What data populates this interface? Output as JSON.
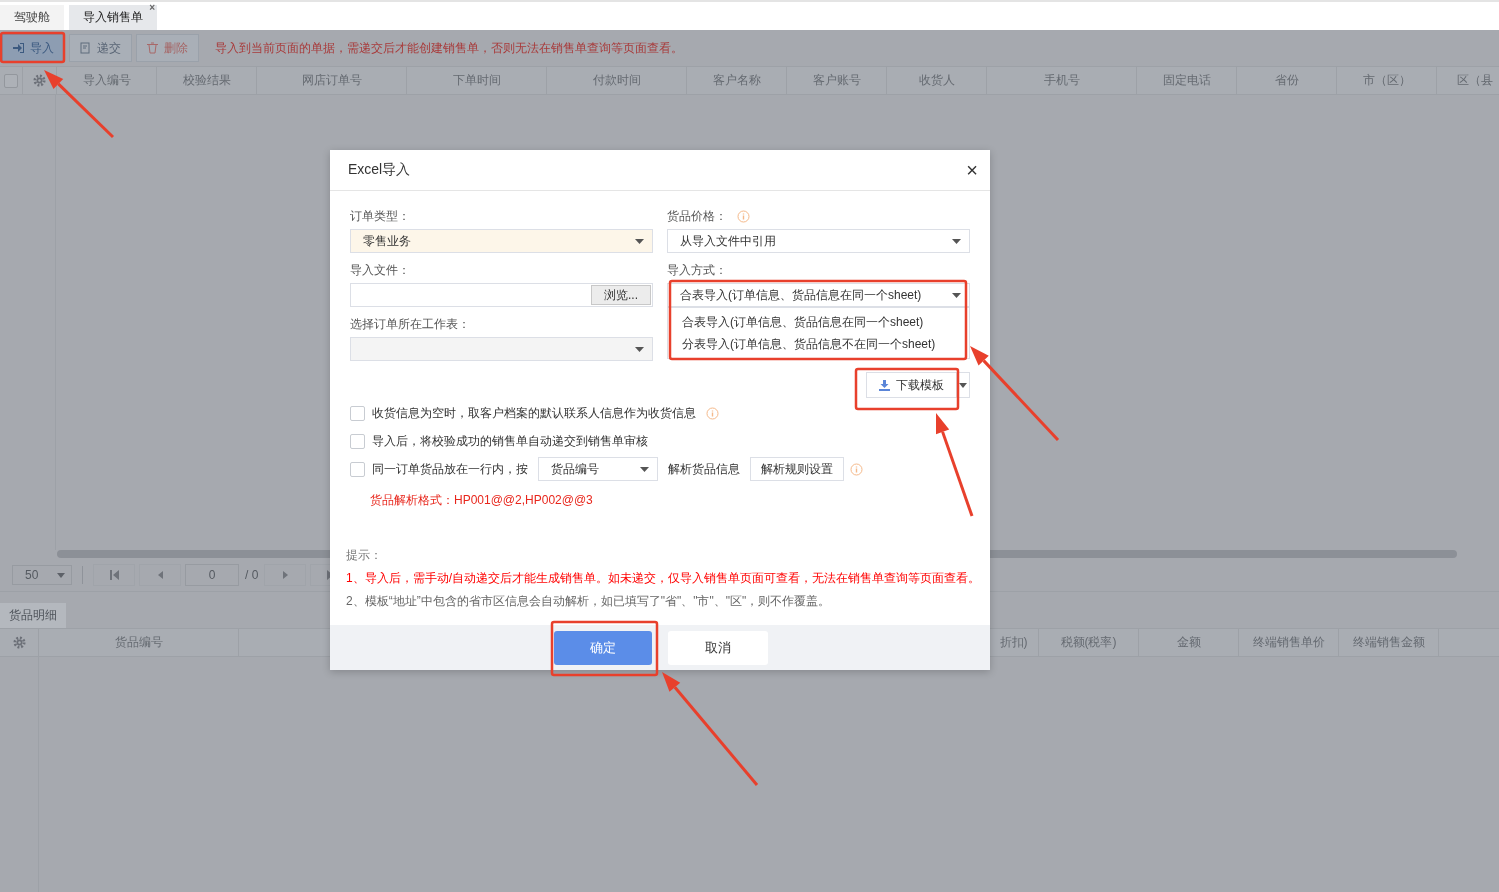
{
  "tabs": [
    {
      "label": "驾驶舱",
      "selected": false
    },
    {
      "label": "导入销售单",
      "selected": true,
      "close": "×"
    }
  ],
  "toolbar": {
    "buttons": [
      {
        "label": "导入",
        "kind": "import"
      },
      {
        "label": "递交",
        "kind": "submit"
      },
      {
        "label": "删除",
        "kind": "delete"
      }
    ],
    "notice": "导入到当前页面的单据，需递交后才能创建销售单，否则无法在销售单查询等页面查看。"
  },
  "table": {
    "select_all": {
      "checked": false
    },
    "columns": [
      "导入编号",
      "校验结果",
      "网店订单号",
      "下单时间",
      "付款时间",
      "客户名称",
      "客户账号",
      "收货人",
      "手机号",
      "固定电话",
      "省份",
      "市（区）",
      "区（县"
    ]
  },
  "pager": {
    "page_size": "50",
    "page": "0",
    "total": "/ 0"
  },
  "detail": {
    "tab": "货品明细",
    "columns_left": [
      "货品编号"
    ],
    "columns_right": [
      "折扣)",
      "税额(税率)",
      "金额",
      "终端销售单价",
      "终端销售金额"
    ]
  },
  "dialog": {
    "title": "Excel导入",
    "close": "×",
    "order_type": {
      "label": "订单类型：",
      "value": "零售业务"
    },
    "price": {
      "label": "货品价格：",
      "value": "从导入文件中引用"
    },
    "file": {
      "label": "导入文件：",
      "browse": "浏览..."
    },
    "import_mode": {
      "label": "导入方式：",
      "value": "合表导入(订单信息、货品信息在同一个sheet)",
      "expanded": true,
      "options": [
        "合表导入(订单信息、货品信息在同一个sheet)",
        "分表导入(订单信息、货品信息不在同一个sheet)"
      ]
    },
    "sheet": {
      "label": "选择订单所在工作表："
    },
    "download": "下载模板",
    "options": [
      {
        "label": "收货信息为空时，取客户档案的默认联系人信息作为收货信息",
        "checked": false,
        "kind": "info"
      },
      {
        "label": "导入后，将校验成功的销售单自动递交到销售单审核",
        "checked": false,
        "kind": "plain"
      },
      {
        "label": "同一订单货品放在一行内，按",
        "checked": false,
        "kind": "parse",
        "select": "货品编号",
        "after": "解析货品信息",
        "button": "解析规则设置"
      }
    ],
    "format": "货品解析格式：HP001@@2,HP002@@3",
    "tips_title": "提示：",
    "tips": [
      {
        "text": "1、导入后，需手动/自动递交后才能生成销售单。如未递交，仅导入销售单页面可查看，无法在销售单查询等页面查看。",
        "kind": "warning"
      },
      {
        "text": "2、模板“地址”中包含的省市区信息会自动解析，如已填写了\"省\"、\"市\"、\"区\"，则不作覆盖。",
        "kind": "normal"
      }
    ],
    "ok": "确定",
    "cancel": "取消"
  }
}
